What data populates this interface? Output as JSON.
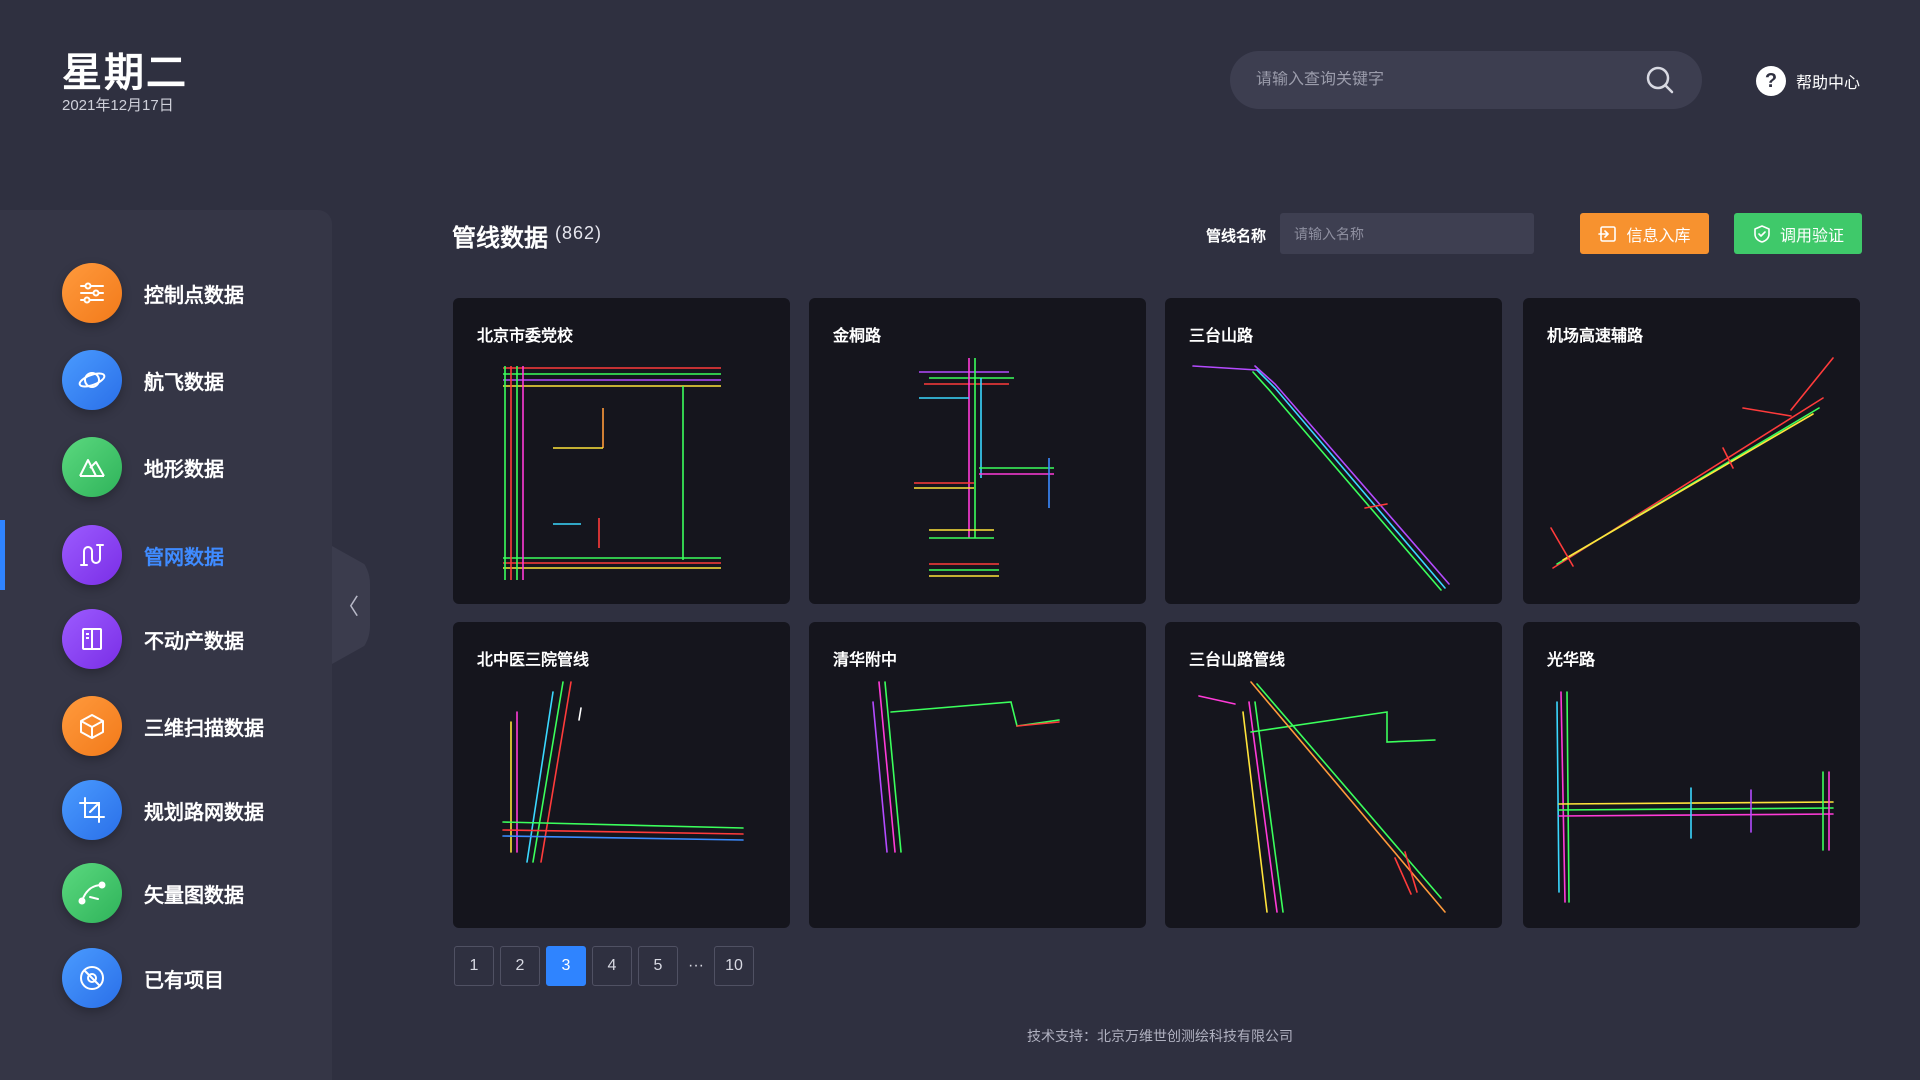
{
  "header": {
    "day": "星期二",
    "date": "2021年12月17日",
    "search_placeholder": "请输入查询关键字",
    "help_label": "帮助中心"
  },
  "sidebar": {
    "items": [
      {
        "label": "控制点数据",
        "icon": "sliders-icon",
        "color": "#f7922f"
      },
      {
        "label": "航飞数据",
        "icon": "planet-icon",
        "color": "#2f84ff"
      },
      {
        "label": "地形数据",
        "icon": "mountain-icon",
        "color": "#3fc96a"
      },
      {
        "label": "管网数据",
        "icon": "pipe-icon",
        "color": "#8a43f0"
      },
      {
        "label": "不动产数据",
        "icon": "book-icon",
        "color": "#8a43f0"
      },
      {
        "label": "三维扫描数据",
        "icon": "cube-icon",
        "color": "#f7922f"
      },
      {
        "label": "规划路网数据",
        "icon": "crop-icon",
        "color": "#2f84ff"
      },
      {
        "label": "矢量图数据",
        "icon": "vector-pen-icon",
        "color": "#3fc96a"
      },
      {
        "label": "已有项目",
        "icon": "disc-icon",
        "color": "#2f84ff"
      }
    ],
    "active_index": 3
  },
  "main": {
    "title": "管线数据",
    "count": "(862)",
    "filter_label": "管线名称",
    "filter_placeholder": "请输入名称",
    "import_label": "信息入库",
    "verify_label": "调用验证",
    "cards": [
      {
        "title": "北京市委党校"
      },
      {
        "title": "金桐路"
      },
      {
        "title": "三台山路"
      },
      {
        "title": "机场高速辅路"
      },
      {
        "title": "北中医三院管线"
      },
      {
        "title": "清华附中"
      },
      {
        "title": "三台山路管线"
      },
      {
        "title": "光华路"
      }
    ]
  },
  "pagination": {
    "pages": [
      "1",
      "2",
      "3",
      "4",
      "5"
    ],
    "ellipsis": "···",
    "last": "10",
    "current": "3"
  },
  "footer": {
    "text": "技术支持：北京万维世创测绘科技有限公司"
  }
}
